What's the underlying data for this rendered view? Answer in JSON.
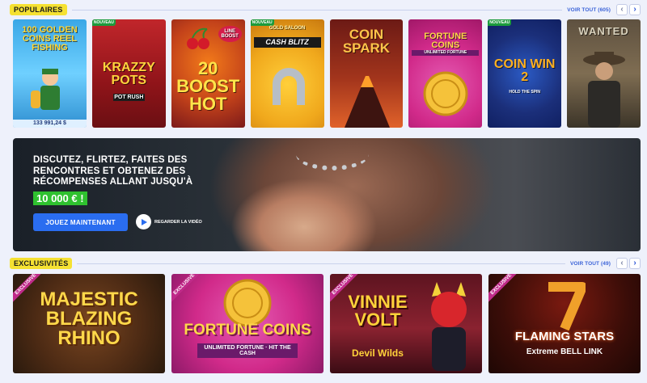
{
  "popular": {
    "tag": "POPULAIRES",
    "see_all": "VOIR TOUT (605)",
    "prev": "‹",
    "next": "›",
    "games": [
      {
        "title": "100 GOLDEN COINS REEL FISHING",
        "badge": "",
        "jackpot": "133 991,24 $",
        "colors": [
          "#3aa7e6",
          "#6fd0ff",
          "#2f8fd1"
        ]
      },
      {
        "title": "KRAZZY POTS",
        "badge": "NOUVEAU",
        "sub": "POT RUSH",
        "jackpot": "",
        "colors": [
          "#c1262b",
          "#8f1419",
          "#6b0f13"
        ]
      },
      {
        "title": "20 BOOST HOT",
        "badge": "",
        "sub": "LINE BOOST",
        "jackpot": "",
        "colors": [
          "#f27a1a",
          "#c3421a",
          "#7c1a1a"
        ]
      },
      {
        "title": "CASH BLITZ",
        "badge": "NOUVEAU",
        "sub": "GOLD SALOON",
        "jackpot": "",
        "colors": [
          "#ffcf3a",
          "#f0a81c",
          "#c97a10"
        ]
      },
      {
        "title": "COIN SPARK",
        "badge": "",
        "jackpot": "",
        "colors": [
          "#6c1a15",
          "#a3351c",
          "#e0622a"
        ]
      },
      {
        "title": "FORTUNE COINS",
        "badge": "",
        "sub": "UNLIMITED FORTUNE",
        "jackpot": "",
        "colors": [
          "#d12a8a",
          "#e55cb4",
          "#a11868"
        ]
      },
      {
        "title": "COIN WIN 2",
        "badge": "NOUVEAU",
        "sub": "HOLD THE SPIN",
        "jackpot": "",
        "colors": [
          "#1b2f7a",
          "#2b5ac4",
          "#102062"
        ]
      },
      {
        "title": "WANTED",
        "badge": "",
        "jackpot": "",
        "colors": [
          "#5e5140",
          "#7f6d52",
          "#3b3428"
        ]
      }
    ]
  },
  "banner": {
    "headline": "DISCUTEZ, FLIRTEZ, FAITES DES RENCONTRES ET OBTENEZ DES RÉCOMPENSES ALLANT JUSQU'À",
    "amount": "10 000 € !",
    "cta": "JOUEZ MAINTENANT",
    "video_label": "REGARDER LA VIDÉO"
  },
  "exclusives": {
    "tag": "EXCLUSIVITÉS",
    "see_all": "VOIR TOUT (49)",
    "prev": "‹",
    "next": "›",
    "ribbon": "EXCLUSIVE",
    "games": [
      {
        "title": "MAJESTIC BLAZING RHINO",
        "sub": "",
        "colors": [
          "#4c2a14",
          "#7a4620",
          "#2a1a0d"
        ]
      },
      {
        "title": "FORTUNE COINS",
        "sub": "UNLIMITED FORTUNE · HIT THE CASH",
        "colors": [
          "#d12a8a",
          "#e55cb4",
          "#8d1a68"
        ]
      },
      {
        "title": "VINNIE VOLT",
        "sub": "Devil Wilds",
        "colors": [
          "#5d1420",
          "#8a2230",
          "#3b0c14"
        ]
      },
      {
        "title": "FLAMING STARS",
        "sub": "Extreme BELL LINK",
        "colors": [
          "#3b0d08",
          "#7a1a10",
          "#1e0704"
        ]
      }
    ]
  }
}
